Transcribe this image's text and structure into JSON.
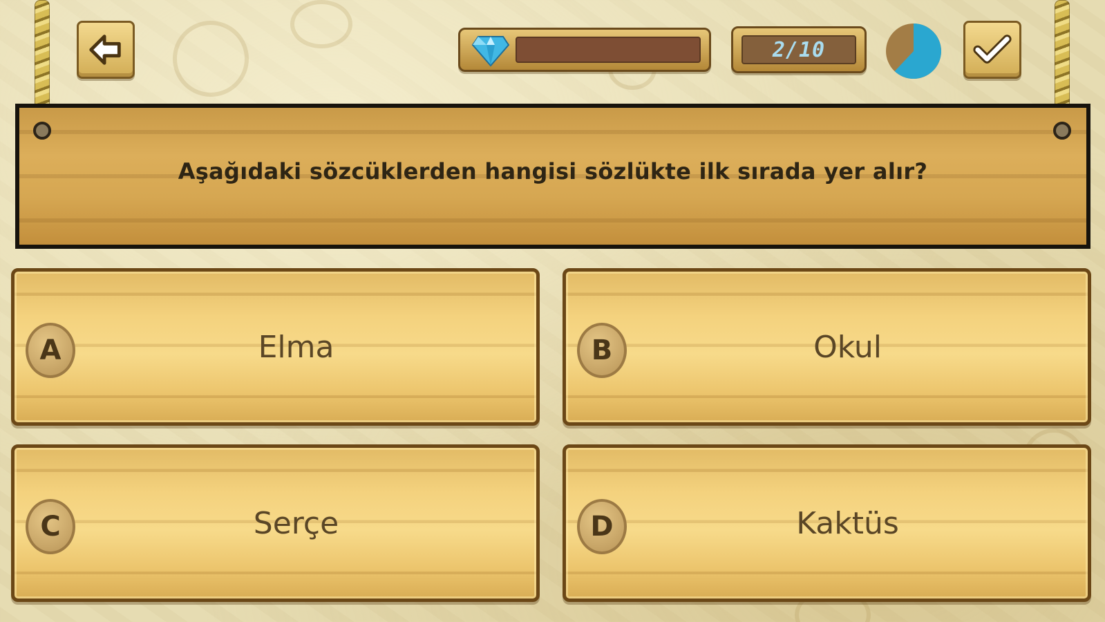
{
  "header": {
    "back_icon": "back-arrow-icon",
    "confirm_icon": "checkmark-icon",
    "gem_icon": "diamond-icon",
    "progress_fraction": 0.0,
    "counter": "2/10",
    "timer_remaining_fraction": 0.62
  },
  "question": {
    "text": "Aşağıdaki sözcüklerden hangisi sözlükte ilk sırada yer alır?"
  },
  "answers": [
    {
      "letter": "A",
      "text": "Elma"
    },
    {
      "letter": "B",
      "text": "Okul"
    },
    {
      "letter": "C",
      "text": "Serçe"
    },
    {
      "letter": "D",
      "text": "Kaktüs"
    }
  ],
  "colors": {
    "accent_blue": "#37b3d6",
    "wood": "#f4d27e",
    "dark_outline": "#17130c",
    "background": "#e6dcb2"
  }
}
